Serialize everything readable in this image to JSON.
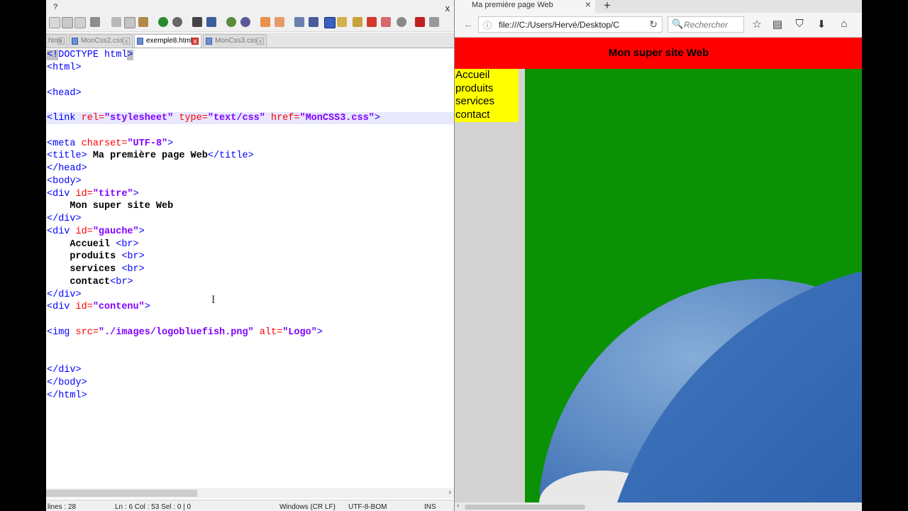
{
  "editor": {
    "menu_help": "?",
    "menu_close": "x",
    "tabs": [
      {
        "label": "html"
      },
      {
        "label": "MonCss2.css"
      },
      {
        "label": "exemple8.html"
      },
      {
        "label": "MonCss3.css"
      }
    ],
    "active_tab": "exemple8.html",
    "tab_close_glyph": "x",
    "code": {
      "l1_pre": "<",
      "l1_sel": "!",
      "l1_mid": "DOCTYPE html",
      "l1_end": ">",
      "l2": "<html>",
      "l4": "<head>",
      "l6_link": "<link",
      "l6_rel_attr": " rel=",
      "l6_rel_val": "\"stylesheet\"",
      "l6_type_attr": " type=",
      "l6_type_val": "\"text/css\"",
      "l6_href_attr": " href=",
      "l6_href_val": "\"MonCSS3.css\"",
      "l6_close": ">",
      "l8_meta": "<meta",
      "l8_attr": " charset=",
      "l8_val": "\"UTF-8\"",
      "l8_close": ">",
      "l9_open": "<title>",
      "l9_text": " Ma première page Web",
      "l9_close": "</title>",
      "l10": "</head>",
      "l11": "<body>",
      "l12_open": "<div",
      "l12_attr": " id=",
      "l12_val": "\"titre\"",
      "l12_close": ">",
      "l13_text": "    Mon super site Web",
      "l14": "</div>",
      "l15_open": "<div",
      "l15_attr": " id=",
      "l15_val": "\"gauche\"",
      "l15_close": ">",
      "l16_text": "    Accueil ",
      "l16_br": "<br>",
      "l17_text": "    produits ",
      "l17_br": "<br>",
      "l18_text": "    services ",
      "l18_br": "<br>",
      "l19_text": "    contact",
      "l19_br": "<br>",
      "l20": "</div>",
      "l21_open": "<div",
      "l21_attr": " id=",
      "l21_val": "\"contenu\"",
      "l21_close": ">",
      "l23_img": "<img",
      "l23_src_attr": " src=",
      "l23_src_val": "\"./images/logobluefish.png\"",
      "l23_alt_attr": " alt=",
      "l23_alt_val": "\"Logo\"",
      "l23_close": ">",
      "l26": "</div>",
      "l27": "</body>",
      "l28": "</html>"
    },
    "status": {
      "lines": "lines : 28",
      "position": "Ln : 6    Col : 53    Sel : 0 | 0",
      "eol": "Windows (CR LF)",
      "encoding": "UTF-8-BOM",
      "mode": "INS"
    },
    "scroll_right_glyph": "›"
  },
  "browser": {
    "tab_title": "Ma première page Web",
    "tab_close": "×",
    "new_tab": "+",
    "back_glyph": "←",
    "info_glyph": "ⓘ",
    "url": "file:///C:/Users/Hervé/Desktop/C",
    "reload_glyph": "↻",
    "search_icon_glyph": "🔍",
    "search_placeholder": "Rechercher",
    "toolbar_glyphs": {
      "star": "☆",
      "reader": "▤",
      "pocket": "⛉",
      "download": "⬇",
      "home": "⌂"
    },
    "page": {
      "titre": "Mon super site Web",
      "gauche": [
        "Accueil",
        "produits",
        "services",
        "contact"
      ],
      "colors": {
        "titre": "#ff0000",
        "gauche": "#ffff00",
        "contenu": "#0a9204",
        "body": "#d3d3d3"
      }
    },
    "scroll_left_glyph": "‹"
  }
}
